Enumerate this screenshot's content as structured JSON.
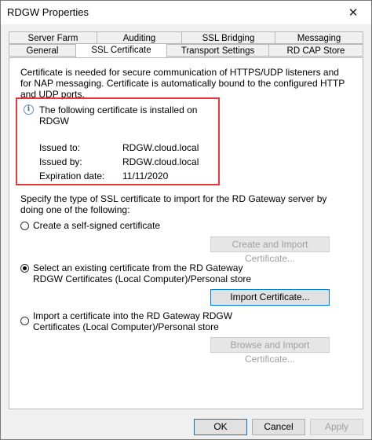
{
  "window": {
    "title": "RDGW Properties",
    "close_glyph": "✕"
  },
  "tabs": {
    "row1": [
      "Server Farm",
      "Auditing",
      "SSL Bridging",
      "Messaging"
    ],
    "row2": [
      "General",
      "SSL Certificate",
      "Transport Settings",
      "RD CAP Store"
    ],
    "active": "SSL Certificate"
  },
  "panel": {
    "intro": "Certificate is needed for secure communication of HTTPS/UDP listeners and for NAP messaging. Certificate is automatically bound to the configured HTTP and UDP ports.",
    "info_icon": "i",
    "installed_text": "The following certificate is installed on RDGW",
    "cert": {
      "issued_to_label": "Issued to:",
      "issued_to": "RDGW.cloud.local",
      "issued_by_label": "Issued by:",
      "issued_by": "RDGW.cloud.local",
      "expiration_label": "Expiration date:",
      "expiration": "11/11/2020"
    },
    "instruction": "Specify the type of SSL certificate to import for the RD Gateway server by doing one of the following:",
    "options": [
      {
        "label": "Create a self-signed certificate",
        "button": "Create and Import Certificate...",
        "checked": false,
        "button_enabled": false
      },
      {
        "label": "Select an existing certificate from the RD Gateway RDGW Certificates (Local Computer)/Personal store",
        "button": "Import Certificate...",
        "checked": true,
        "button_enabled": true
      },
      {
        "label": "Import a certificate into the RD Gateway RDGW Certificates (Local Computer)/Personal store",
        "button": "Browse and Import Certificate...",
        "checked": false,
        "button_enabled": false
      }
    ]
  },
  "footer": {
    "ok": "OK",
    "cancel": "Cancel",
    "apply": "Apply"
  },
  "colors": {
    "highlight_border": "#e8383d",
    "focus_border": "#0078d7",
    "panel_bg": "#ffffff",
    "dialog_bg": "#f0f0f0"
  }
}
